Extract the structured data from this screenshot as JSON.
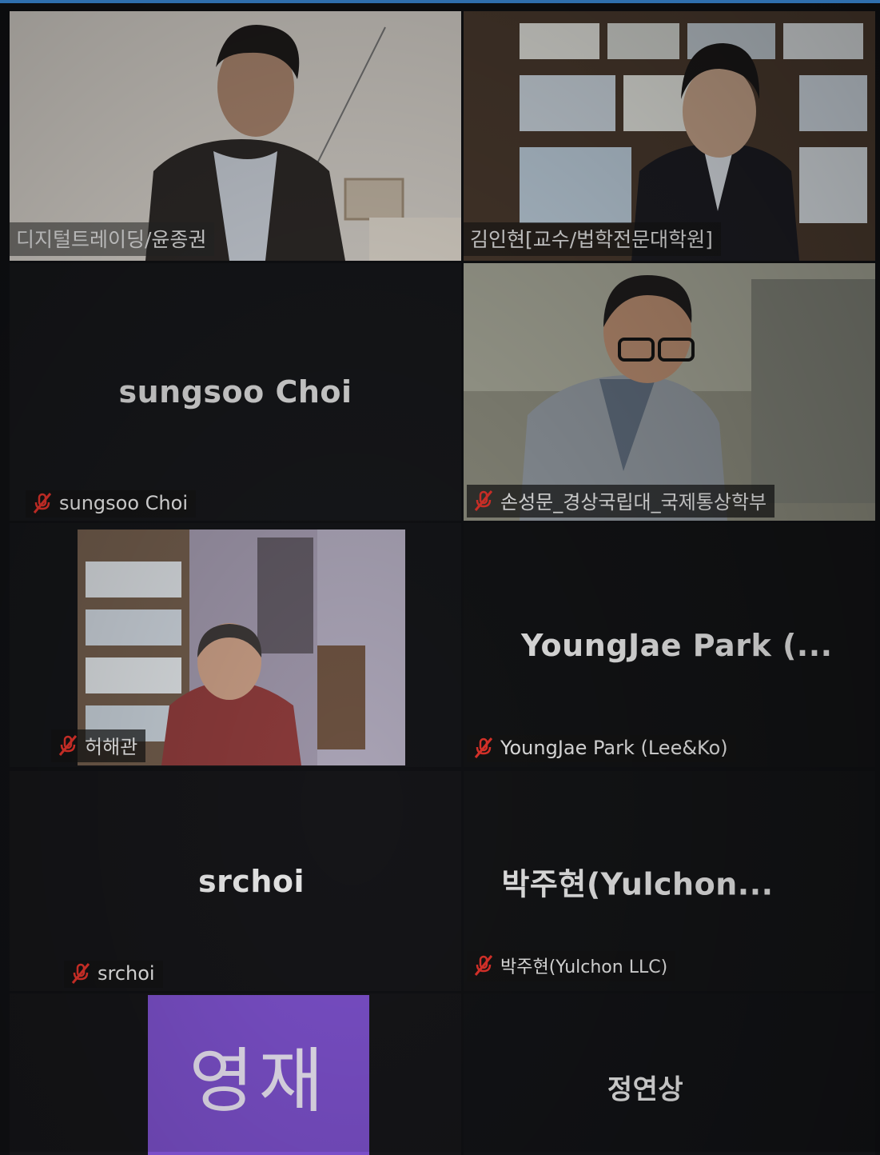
{
  "participants": [
    {
      "display_name": "디지털트레이딩/윤종권",
      "muted": false,
      "speaking": true
    },
    {
      "display_name": "김인현[교수/법학전문대학원]",
      "muted": false
    },
    {
      "display_name": "sungsoo Choi",
      "big_label": "sungsoo Choi",
      "muted": true
    },
    {
      "display_name": "손성문_경상국립대_국제통상학부",
      "muted": true
    },
    {
      "display_name": "허해관",
      "muted": true
    },
    {
      "display_name": "YoungJae Park (Lee&Ko)",
      "big_label": "YoungJae  Park  (...",
      "muted": true
    },
    {
      "display_name": "srchoi",
      "big_label": "srchoi",
      "muted": true
    },
    {
      "display_name": "박주현(Yulchon LLC)",
      "big_label": "박주현(Yulchon...",
      "muted": true
    },
    {
      "avatar_text": "영재"
    },
    {
      "big_label": "정연상"
    }
  ],
  "colors": {
    "speaking_border": "#c9de55",
    "mute": "#e0332b",
    "avatar_bg": "#7a4fc8",
    "top_bar": "#2f6fae"
  },
  "icons": {
    "mute": "muted-mic-icon"
  }
}
